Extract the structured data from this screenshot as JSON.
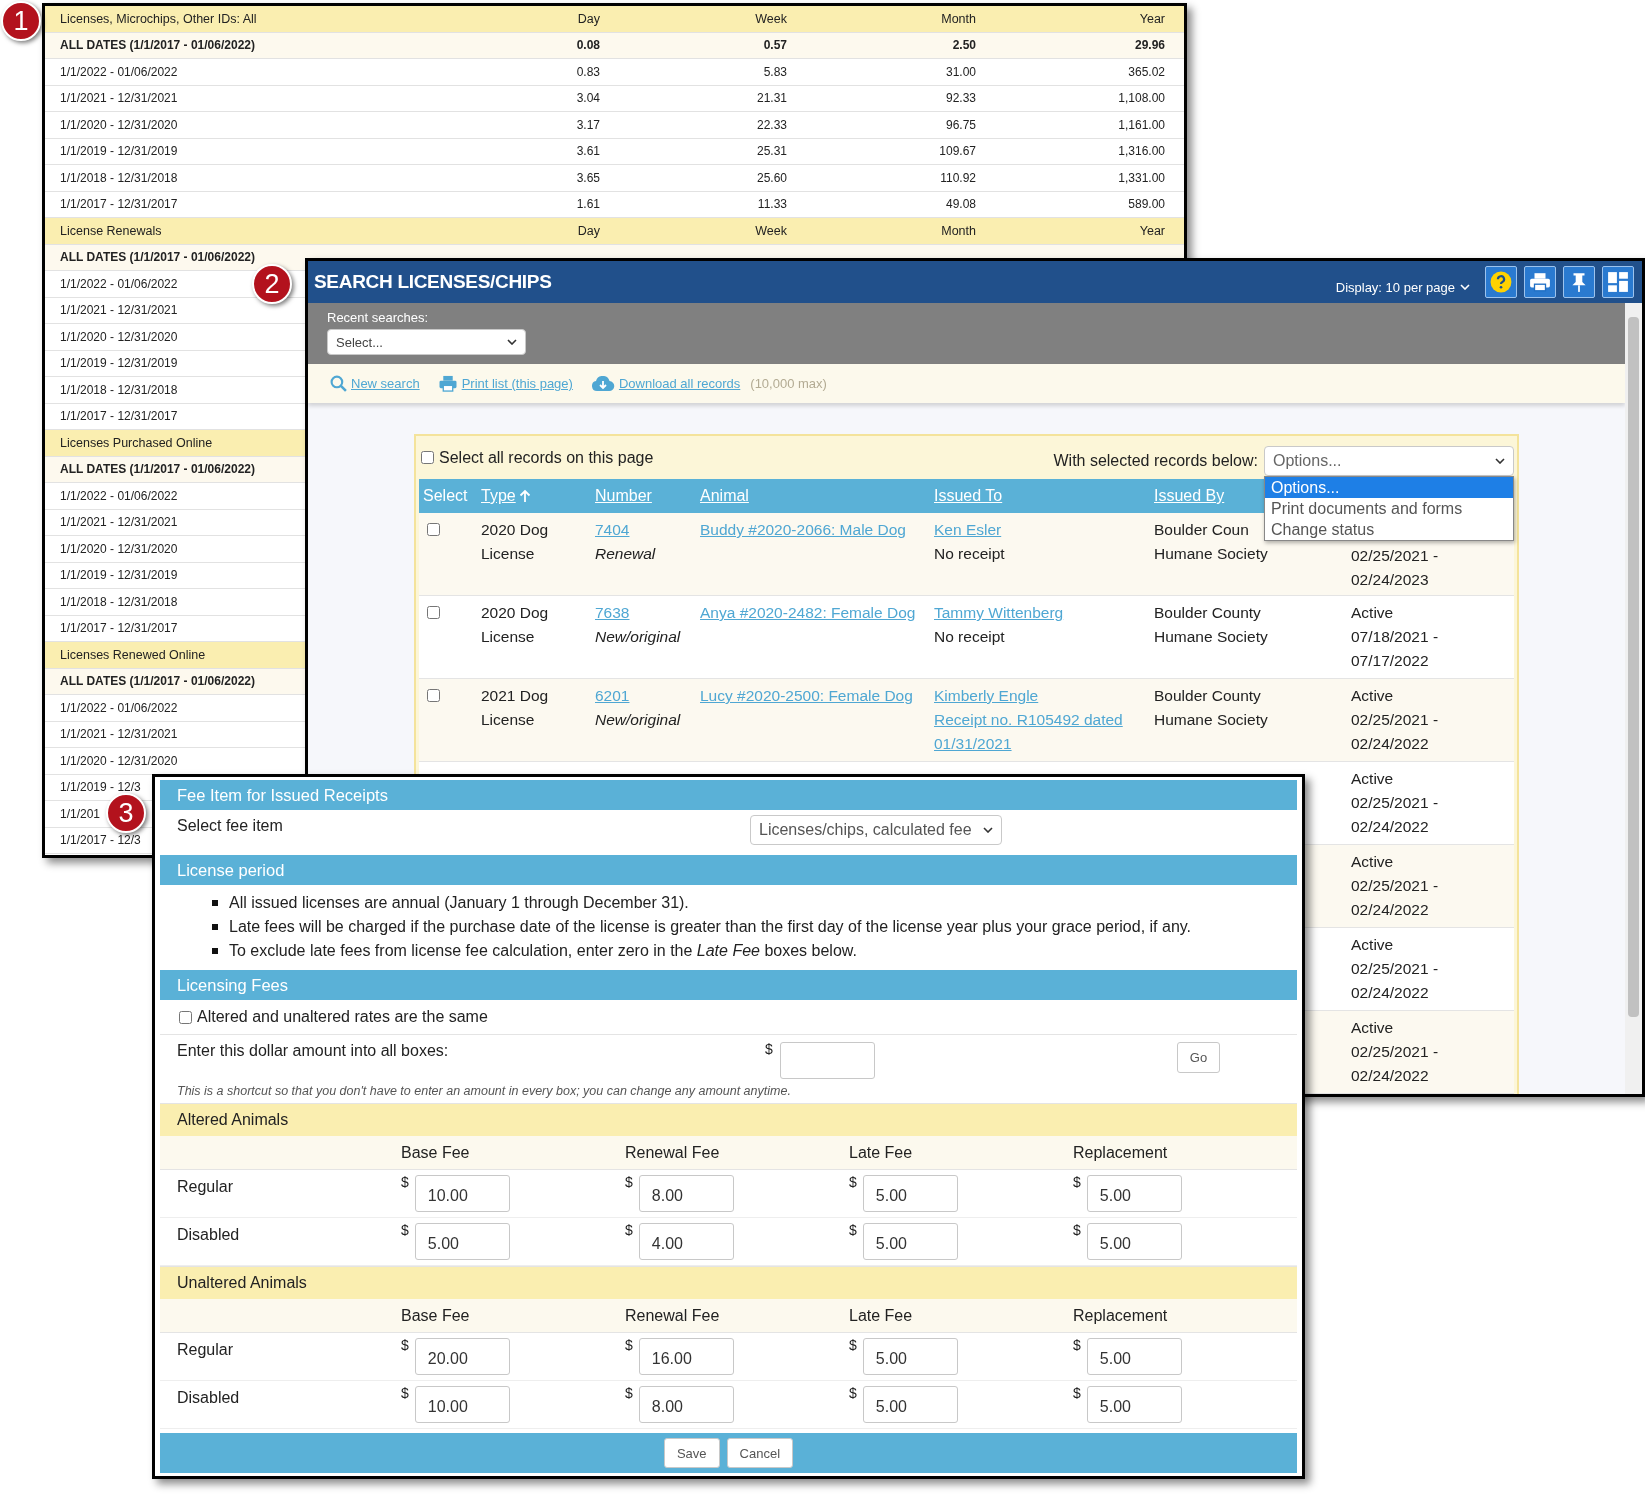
{
  "report_window": {
    "badge": "1",
    "sections": [
      {
        "title": "Licenses, Microchips, Other IDs: All",
        "columns": [
          "Day",
          "Week",
          "Month",
          "Year"
        ],
        "rows": [
          {
            "kind": "total",
            "label": "ALL DATES (1/1/2017 - 01/06/2022)",
            "values": [
              "0.08",
              "0.57",
              "2.50",
              "29.96"
            ]
          },
          {
            "kind": "period",
            "label": "1/1/2022 - 01/06/2022",
            "values": [
              "0.83",
              "5.83",
              "31.00",
              "365.02"
            ]
          },
          {
            "kind": "period",
            "label": "1/1/2021 - 12/31/2021",
            "values": [
              "3.04",
              "21.31",
              "92.33",
              "1,108.00"
            ]
          },
          {
            "kind": "period",
            "label": "1/1/2020 - 12/31/2020",
            "values": [
              "3.17",
              "22.33",
              "96.75",
              "1,161.00"
            ]
          },
          {
            "kind": "period",
            "label": "1/1/2019 - 12/31/2019",
            "values": [
              "3.61",
              "25.31",
              "109.67",
              "1,316.00"
            ]
          },
          {
            "kind": "period",
            "label": "1/1/2018 - 12/31/2018",
            "values": [
              "3.65",
              "25.60",
              "110.92",
              "1,331.00"
            ]
          },
          {
            "kind": "period",
            "label": "1/1/2017 - 12/31/2017",
            "values": [
              "1.61",
              "11.33",
              "49.08",
              "589.00"
            ]
          }
        ]
      },
      {
        "title": "License Renewals",
        "columns": [
          "Day",
          "Week",
          "Month",
          "Year"
        ],
        "rows": [
          {
            "kind": "total",
            "label": "ALL DATES (1/1/2017 - 01/06/2022)"
          },
          {
            "kind": "period",
            "label": "1/1/2022 - 01/06/2022"
          },
          {
            "kind": "period",
            "label": "1/1/2021 - 12/31/2021"
          },
          {
            "kind": "period",
            "label": "1/1/2020 - 12/31/2020"
          },
          {
            "kind": "period",
            "label": "1/1/2019 - 12/31/2019"
          },
          {
            "kind": "period",
            "label": "1/1/2018 - 12/31/2018"
          },
          {
            "kind": "period",
            "label": "1/1/2017 - 12/31/2017"
          }
        ]
      },
      {
        "title": "Licenses Purchased Online",
        "rows": [
          {
            "kind": "total",
            "label": "ALL DATES (1/1/2017 - 01/06/2022)"
          },
          {
            "kind": "period",
            "label": "1/1/2022 - 01/06/2022"
          },
          {
            "kind": "period",
            "label": "1/1/2021 - 12/31/2021"
          },
          {
            "kind": "period",
            "label": "1/1/2020 - 12/31/2020"
          },
          {
            "kind": "period",
            "label": "1/1/2019 - 12/31/2019"
          },
          {
            "kind": "period",
            "label": "1/1/2018 - 12/31/2018"
          },
          {
            "kind": "period",
            "label": "1/1/2017 - 12/31/2017"
          }
        ]
      },
      {
        "title": "Licenses Renewed Online",
        "rows": [
          {
            "kind": "total",
            "label": "ALL DATES (1/1/2017 - 01/06/2022)"
          },
          {
            "kind": "period",
            "label": "1/1/2022 - 01/06/2022"
          },
          {
            "kind": "period",
            "label": "1/1/2021 - 12/31/2021"
          },
          {
            "kind": "period",
            "label": "1/1/2020 - 12/31/2020"
          },
          {
            "kind": "period",
            "label": "1/1/2019 - 12/3"
          },
          {
            "kind": "period",
            "label": "1/1/201"
          },
          {
            "kind": "period",
            "label": "1/1/2017 - 12/3"
          }
        ]
      }
    ]
  },
  "search_window": {
    "badge": "2",
    "title": "SEARCH LICENSES/CHIPS",
    "display": "Display: 10 per page",
    "recent_label": "Recent searches:",
    "recent_select": "Select...",
    "toolbar": [
      {
        "kind": "search",
        "label": "New search"
      },
      {
        "kind": "print",
        "label": "Print list (this page)"
      },
      {
        "kind": "download",
        "label": "Download all records"
      }
    ],
    "download_note": "(10,000 max)",
    "select_all": {
      "label": "Select all records on this page",
      "checked": false
    },
    "bulk_label": "With selected records below:",
    "bulk_select": "Options...",
    "bulk_options": [
      {
        "label": "Options...",
        "selected": true
      },
      {
        "label": "Print documents and forms",
        "selected": false
      },
      {
        "label": "Change status",
        "selected": false
      }
    ],
    "columns": [
      {
        "label": "Select",
        "link": false
      },
      {
        "label": "Type",
        "link": true,
        "sort_ascending": true
      },
      {
        "label": "Number",
        "link": true
      },
      {
        "label": "Animal",
        "link": true
      },
      {
        "label": "Issued To",
        "link": true
      },
      {
        "label": "Issued By",
        "link": true
      }
    ],
    "rows": [
      {
        "checked": false,
        "type": "2020 Dog License",
        "number": "7404",
        "subtype": "Renewal",
        "animal": "Buddy #2020-2066: Male Dog",
        "issued_to": "Ken Esler",
        "receipt": "No receipt",
        "receipt_link": false,
        "issued_by": [
          "Boulder Coun",
          "Humane Society"
        ],
        "period": "02/25/2021 - 02/24/2023"
      },
      {
        "checked": false,
        "type": "2020 Dog License",
        "number": "7638",
        "subtype": "New/original",
        "animal": "Anya #2020-2482: Female Dog",
        "issued_to": "Tammy Wittenberg",
        "receipt": "No receipt",
        "receipt_link": false,
        "issued_by": [
          "Boulder County",
          "Humane Society"
        ],
        "status": "Active",
        "period": "07/18/2021 - 07/17/2022"
      },
      {
        "checked": false,
        "type": "2021 Dog License",
        "number": "6201",
        "subtype": "New/original",
        "animal": "Lucy #2020-2500: Female Dog",
        "issued_to": "Kimberly Engle",
        "receipt": "Receipt no. R105492 dated 01/31/2021",
        "receipt_link": true,
        "issued_by": [
          "Boulder County",
          "Humane Society"
        ],
        "status": "Active",
        "period": "02/25/2021 - 02/24/2022"
      },
      {
        "status": "Active",
        "period": "02/25/2021 - 02/24/2022"
      },
      {
        "status": "Active",
        "period": "02/25/2021 - 02/24/2022"
      },
      {
        "status": "Active",
        "period": "02/25/2021 - 02/24/2022"
      },
      {
        "status": "Active",
        "period": "02/25/2021 - 02/24/2022"
      }
    ]
  },
  "fee_window": {
    "badge": "3",
    "fee_item": {
      "title": "Fee Item for Issued Receipts",
      "label": "Select fee item",
      "value": "Licenses/chips, calculated fee"
    },
    "period": {
      "title": "License period",
      "notes": [
        "All issued licenses are annual (January 1 through December 31).",
        "Late fees will be charged if the purchase date of the license is greater than the first day of the license year plus your grace period, if any.",
        "To exclude late fees from license fee calculation, enter zero in the *Late Fee* boxes below."
      ]
    },
    "fees": {
      "title": "Licensing Fees",
      "same_rates": {
        "label": "Altered and unaltered rates are the same",
        "checked": false
      },
      "fill_label": "Enter this dollar amount into all boxes:",
      "currency": "$",
      "fill_button": "Go",
      "hint": "This is a shortcut so that you don't have to enter an amount in every box; you can change any amount anytime."
    },
    "groups": [
      {
        "title": "Altered Animals",
        "columns": [
          "Base Fee",
          "Renewal Fee",
          "Late Fee",
          "Replacement"
        ],
        "rows": [
          {
            "label": "Regular",
            "values": [
              {
                "currency": "$",
                "amount": "10.00"
              },
              {
                "currency": "$",
                "amount": "8.00"
              },
              {
                "currency": "$",
                "amount": "5.00"
              },
              {
                "currency": "$",
                "amount": "5.00"
              }
            ]
          },
          {
            "label": "Disabled",
            "values": [
              {
                "currency": "$",
                "amount": "5.00"
              },
              {
                "currency": "$",
                "amount": "4.00"
              },
              {
                "currency": "$",
                "amount": "5.00"
              },
              {
                "currency": "$",
                "amount": "5.00"
              }
            ]
          }
        ]
      },
      {
        "title": "Unaltered Animals",
        "columns": [
          "Base Fee",
          "Renewal Fee",
          "Late Fee",
          "Replacement"
        ],
        "rows": [
          {
            "label": "Regular",
            "values": [
              {
                "currency": "$",
                "amount": "20.00"
              },
              {
                "currency": "$",
                "amount": "16.00"
              },
              {
                "currency": "$",
                "amount": "5.00"
              },
              {
                "currency": "$",
                "amount": "5.00"
              }
            ]
          },
          {
            "label": "Disabled",
            "values": [
              {
                "currency": "$",
                "amount": "10.00"
              },
              {
                "currency": "$",
                "amount": "8.00"
              },
              {
                "currency": "$",
                "amount": "5.00"
              },
              {
                "currency": "$",
                "amount": "5.00"
              }
            ]
          }
        ]
      }
    ],
    "actions": [
      "Save",
      "Cancel"
    ]
  }
}
